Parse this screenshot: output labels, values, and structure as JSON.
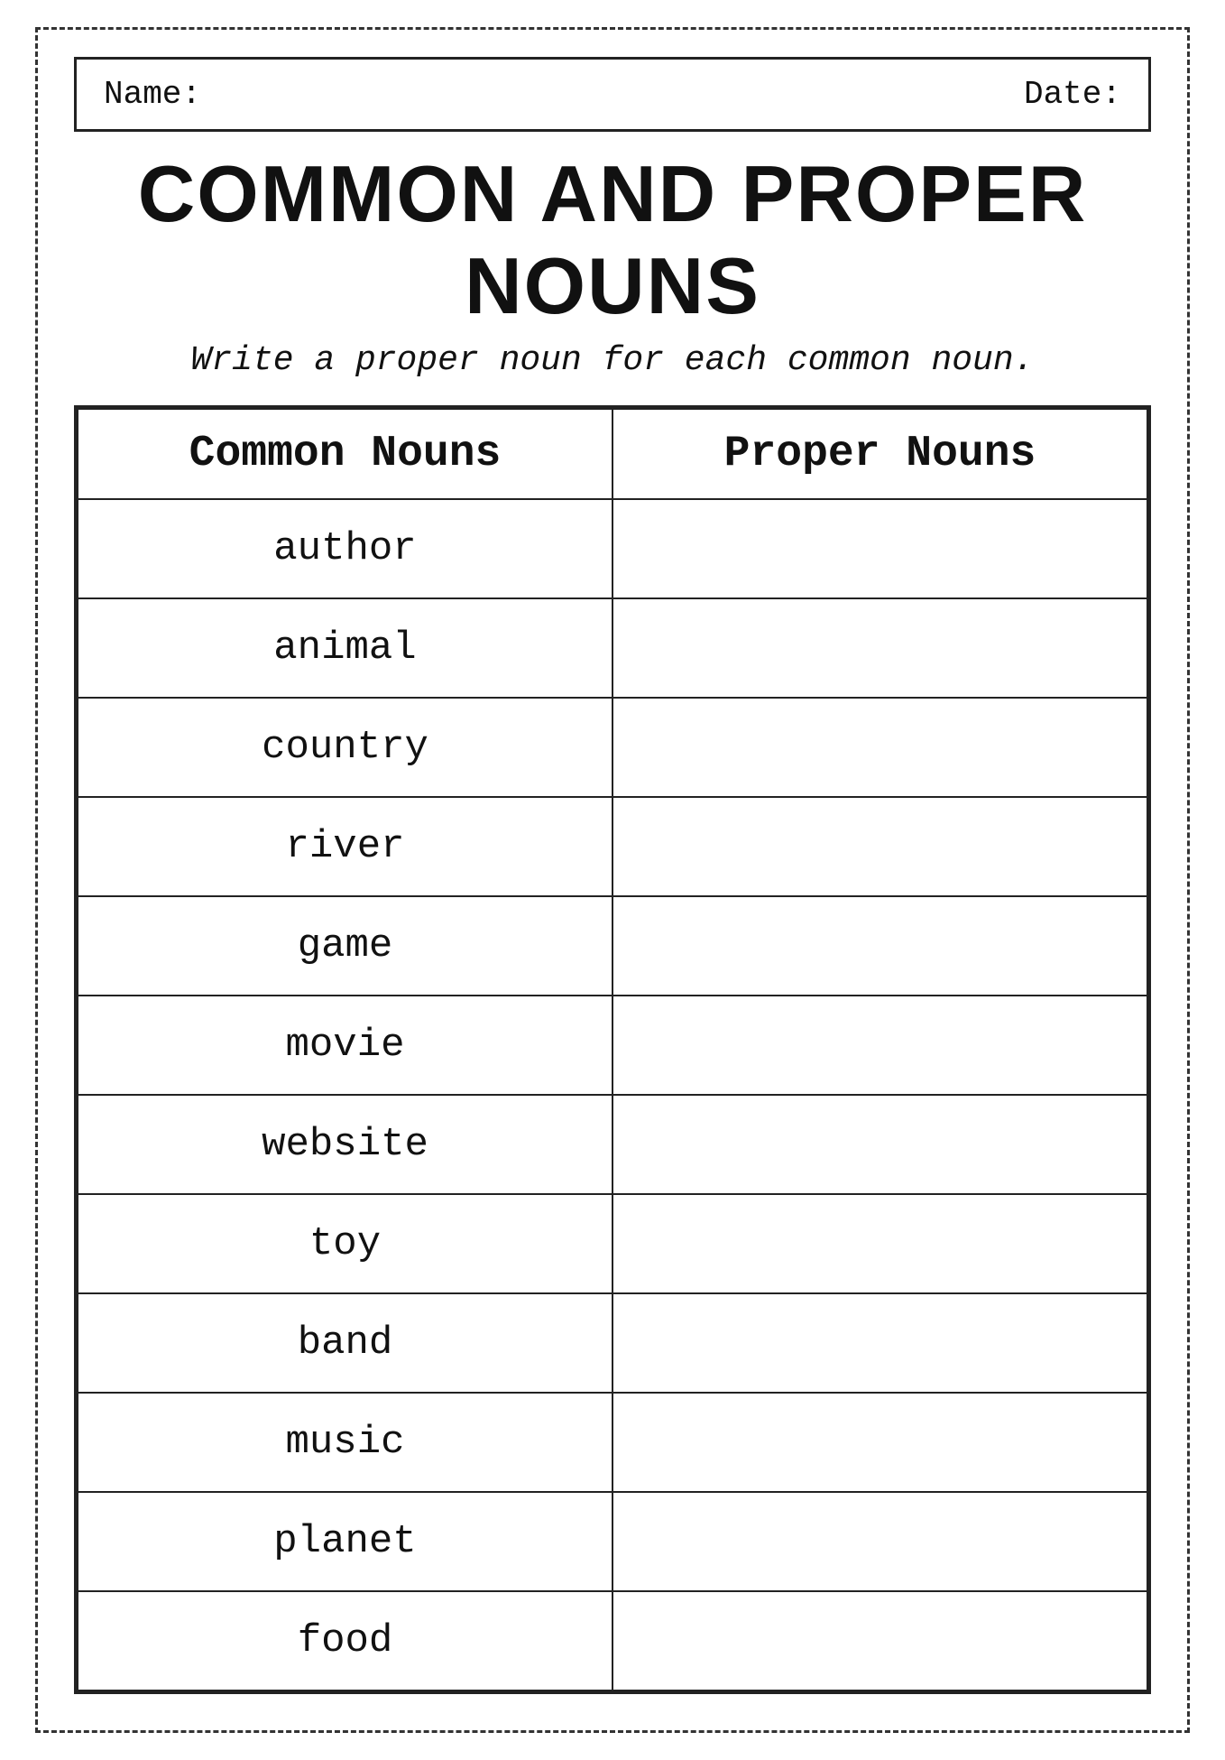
{
  "header": {
    "name_label": "Name:",
    "date_label": "Date:"
  },
  "title": "COMMON AND PROPER NOUNS",
  "subtitle": "Write a proper noun for each common noun.",
  "table": {
    "col1_header": "Common Nouns",
    "col2_header": "Proper Nouns",
    "rows": [
      {
        "common": "author",
        "proper": ""
      },
      {
        "common": "animal",
        "proper": ""
      },
      {
        "common": "country",
        "proper": ""
      },
      {
        "common": "river",
        "proper": ""
      },
      {
        "common": "game",
        "proper": ""
      },
      {
        "common": "movie",
        "proper": ""
      },
      {
        "common": "website",
        "proper": ""
      },
      {
        "common": "toy",
        "proper": ""
      },
      {
        "common": "band",
        "proper": ""
      },
      {
        "common": "music",
        "proper": ""
      },
      {
        "common": "planet",
        "proper": ""
      },
      {
        "common": "food",
        "proper": ""
      }
    ]
  }
}
